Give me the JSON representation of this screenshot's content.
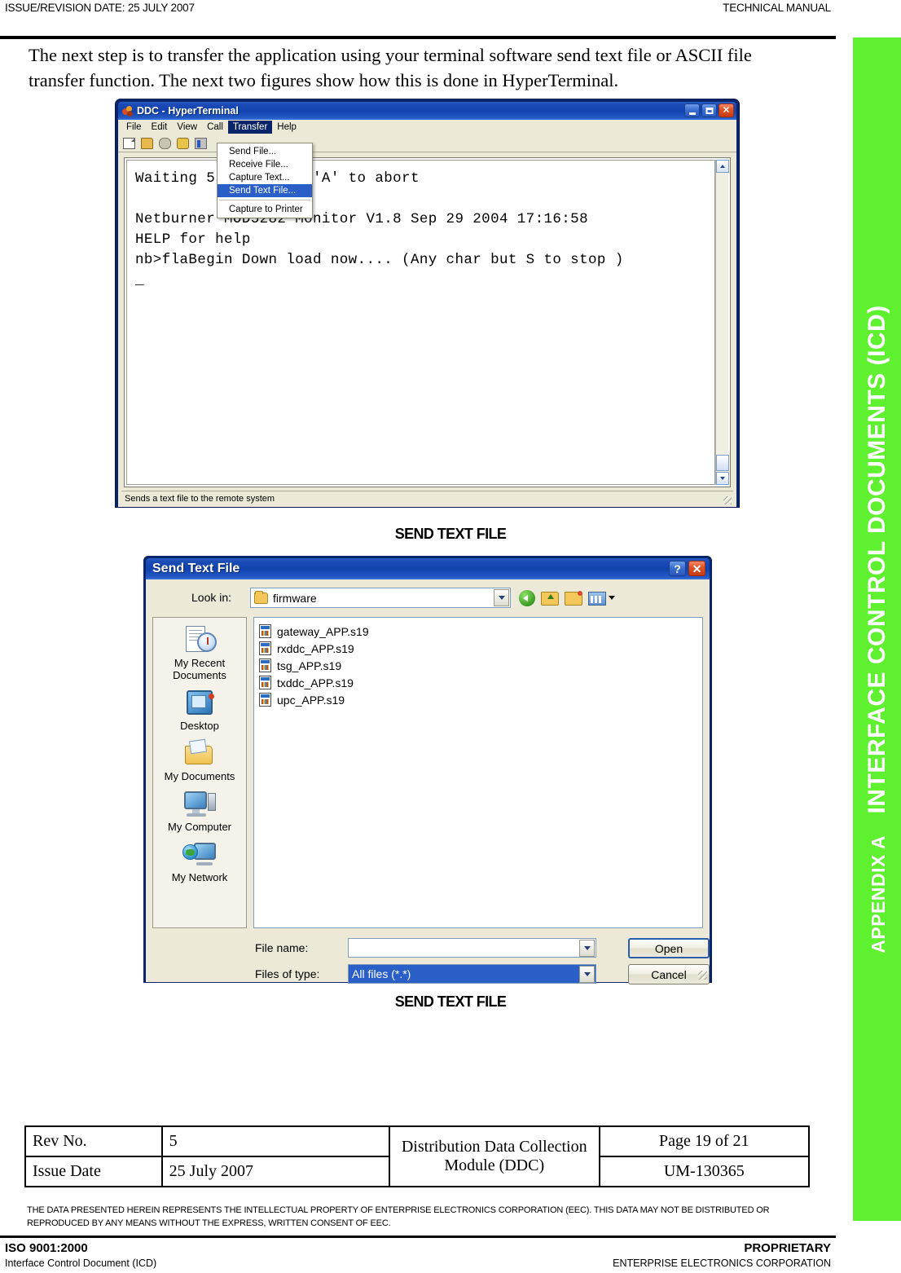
{
  "header": {
    "left": "ISSUE/REVISION DATE:  25 JULY 2007",
    "right": "TECHNICAL MANUAL"
  },
  "intro": {
    "paragraph": "The next step is to transfer the application using your terminal software send text file or ASCII file transfer function. The next two figures show how this is done in HyperTerminal."
  },
  "appendix_tab": {
    "prefix": "APPENDIX A",
    "title": "INTERFACE CONTROL DOCUMENTS (ICD)",
    "color": "#5FF030"
  },
  "hyperterminal": {
    "title": "DDC - HyperTerminal",
    "window_buttons": [
      "minimize",
      "maximize",
      "close"
    ],
    "menus": [
      {
        "label": "File",
        "active": false
      },
      {
        "label": "Edit",
        "active": false
      },
      {
        "label": "View",
        "active": false
      },
      {
        "label": "Call",
        "active": false
      },
      {
        "label": "Transfer",
        "active": true
      },
      {
        "label": "Help",
        "active": false
      }
    ],
    "toolbar_icons": [
      "new-icon",
      "open-icon",
      "phone-icon",
      "disconnect-icon",
      "properties-icon"
    ],
    "transfer_menu": [
      {
        "label": "Send File...",
        "selected": false
      },
      {
        "label": "Receive File...",
        "selected": false
      },
      {
        "label": "Capture Text...",
        "selected": false
      },
      {
        "label": "Send Text File...",
        "selected": true
      },
      {
        "label": "Capture to Printer",
        "selected": false
      }
    ],
    "terminal_lines": [
      "Waiting 5sec, press 'A' to abort",
      "",
      "Netburner MOD5282 Monitor V1.8 Sep 29 2004 17:16:58",
      "HELP for help",
      "nb>flaBegin Down load now.... (Any char but S to stop )",
      "_"
    ],
    "status_bar": "Sends a text file to the remote system"
  },
  "figure_caption_1": "SEND TEXT FILE",
  "send_text_file_dialog": {
    "title": "Send Text File",
    "help_button": "?",
    "close_button": "✕",
    "look_in_label": "Look in:",
    "look_in_value": "firmware",
    "toolbar_icons": [
      "back-icon",
      "up-one-level-icon",
      "new-folder-icon",
      "views-icon"
    ],
    "places": [
      {
        "label": "My Recent\nDocuments",
        "icon": "recent-documents-icon"
      },
      {
        "label": "Desktop",
        "icon": "desktop-icon"
      },
      {
        "label": "My Documents",
        "icon": "my-documents-icon"
      },
      {
        "label": "My Computer",
        "icon": "my-computer-icon"
      },
      {
        "label": "My Network",
        "icon": "my-network-icon"
      }
    ],
    "files": [
      "gateway_APP.s19",
      "rxddc_APP.s19",
      "tsg_APP.s19",
      "txddc_APP.s19",
      "upc_APP.s19"
    ],
    "file_name_label": "File name:",
    "file_name_value": "",
    "files_of_type_label": "Files of type:",
    "files_of_type_value": "All files (*.*)",
    "open_button": "Open",
    "cancel_button": "Cancel"
  },
  "figure_caption_2": "SEND TEXT FILE",
  "info_table": {
    "rev_no_label": "Rev No.",
    "rev_no_value": "5",
    "module_name": "Distribution Data Collection Module (DDC)",
    "page_label": "Page 19 of 21",
    "issue_date_label": "Issue Date",
    "issue_date_value": "25 July 2007",
    "doc_number": "UM-130365"
  },
  "disclaimer": "THE DATA PRESENTED HEREIN REPRESENTS THE INTELLECTUAL PROPERTY OF ENTERPRISE ELECTRONICS CORPORATION (EEC).  THIS DATA MAY NOT BE DISTRIBUTED OR REPRODUCED BY ANY MEANS WITHOUT THE EXPRESS, WRITTEN CONSENT OF EEC.",
  "footer": {
    "left_top": "ISO 9001:2000",
    "left_bottom": "Interface Control Document (ICD)",
    "right_top": "PROPRIETARY",
    "right_bottom": "ENTERPRISE ELECTRONICS CORPORATION"
  }
}
